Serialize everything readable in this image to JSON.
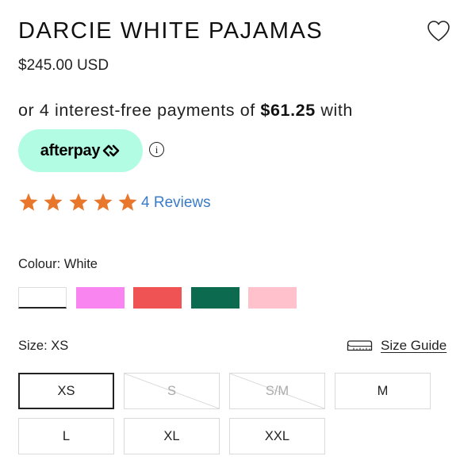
{
  "product": {
    "title": "DARCIE WHITE PAJAMAS",
    "price": "$245.00 USD"
  },
  "wishlist": {
    "icon": "heart-icon"
  },
  "afterpay": {
    "prefix": "or 4 interest-free payments of ",
    "amount": "$61.25",
    "suffix": " with",
    "badge_text": "afterpay",
    "badge_color": "#b2fce4",
    "info_icon": "info-icon"
  },
  "rating": {
    "stars": 5,
    "max": 5,
    "star_color": "#e8772b",
    "reviews_label": "4 Reviews",
    "link_color": "#3a7bc8"
  },
  "colour": {
    "label": "Colour: White",
    "swatches": [
      {
        "name": "White",
        "color": "#ffffff",
        "selected": true
      },
      {
        "name": "Pink",
        "color": "#f986f0",
        "selected": false
      },
      {
        "name": "Red",
        "color": "#f05353",
        "selected": false
      },
      {
        "name": "Green",
        "color": "#0c6b4e",
        "selected": false
      },
      {
        "name": "Light Pink",
        "color": "#ffc1cc",
        "selected": false
      }
    ]
  },
  "size": {
    "label": "Size: XS",
    "guide_label": "Size Guide",
    "guide_icon": "ruler-icon",
    "options": [
      {
        "label": "XS",
        "selected": true,
        "available": true
      },
      {
        "label": "S",
        "selected": false,
        "available": false
      },
      {
        "label": "S/M",
        "selected": false,
        "available": false
      },
      {
        "label": "M",
        "selected": false,
        "available": true
      },
      {
        "label": "L",
        "selected": false,
        "available": true
      },
      {
        "label": "XL",
        "selected": false,
        "available": true
      },
      {
        "label": "XXL",
        "selected": false,
        "available": true
      }
    ]
  }
}
